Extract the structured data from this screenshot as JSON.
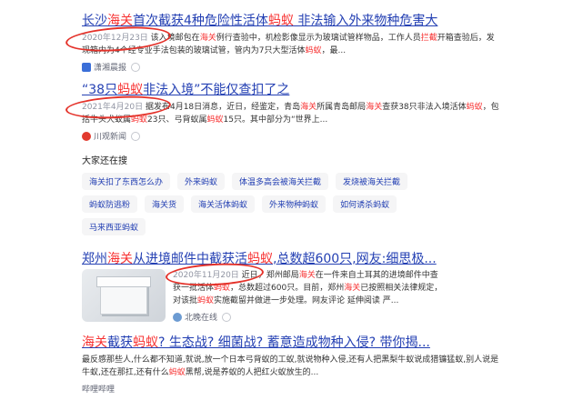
{
  "results": [
    {
      "title_parts": [
        "长沙",
        "海关",
        "首次截获4种危险性活体",
        "蚂蚁",
        " 非法输入外来物种危害大"
      ],
      "date": "2020年12月23日",
      "snippet_parts": [
        " 该入境邮包在",
        "海关",
        "例行查验中，机检影像显示为玻璃试管样物品，工作人员",
        "拦截",
        "开箱查验后，发现箱内为4个经专业手法包装的玻璃试管，管内为7只大型活体",
        "蚂蚁",
        "，最..."
      ],
      "source": "潇湘晨报"
    },
    {
      "title_parts": [
        "“38只",
        "蚂蚁",
        "非法入境”不能仅查扣了之"
      ],
      "date": "2021年4月20日",
      "snippet_parts": [
        " 据",
        "",
        "发布4月18日消息，近日，经鉴定，青岛",
        "海关",
        "所属青岛邮局",
        "海关",
        "查获38只非法入境活体",
        "蚂蚁",
        "，包括牛头犬蚁属",
        "蚂蚁",
        "23只、弓背蚁属",
        "蚂蚁",
        "15只。其中部分为“世界上..."
      ],
      "source": "川观新闻"
    },
    {
      "title_parts": [
        "郑州",
        "海关",
        "从进境邮件中截获活",
        "蚂蚁",
        ",总数超600只,网友:细思极..."
      ],
      "date": "2020年11月20日",
      "snippet_parts": [
        " 近日，",
        "郑州邮局",
        "海关",
        "在一件来自土耳其的进境邮件中查获一批活体",
        "蚂蚁",
        "，总数超过600只。目前，郑州",
        "海关",
        "已按照相关法律规定，对该批",
        "蚂蚁",
        "实施截留并做进一步处理。网友评论 延伸阅读 严..."
      ],
      "source": "北晚在线"
    },
    {
      "title_parts": [
        "海关",
        "截获",
        "蚂蚁",
        "? 生态战? 细菌战? 蓄意造成物种入侵? 带你揭..."
      ],
      "snippet_parts": [
        "最反感那些人,什么都不知道,就说,放一个日本弓背蚁的工蚁,就说物种入侵,还有人把黑梨牛蚁说成猎镰猛蚁,别人说是牛蚁,还在那扛,还有什么",
        "蚂蚁",
        "黑帮,说是养蚁的人把红火蚁放生的..."
      ],
      "source": "哔哩哔哩"
    }
  ],
  "related": {
    "title": "大家还在搜",
    "rows": [
      [
        "海关扣了东西怎么办",
        "外来蚂蚁",
        "体温多高会被海关拦截",
        "发烧被海关拦截"
      ],
      [
        "蚂蚁防逃粉",
        "海关货",
        "海关活体蚂蚁",
        "外来物种蚂蚁",
        "如何诱杀蚂蚁"
      ],
      [
        "马来西亚蚂蚁"
      ]
    ]
  },
  "colors": {
    "link": "#2440b3",
    "highlight": "#f73131",
    "annotation": "#e4322a"
  }
}
